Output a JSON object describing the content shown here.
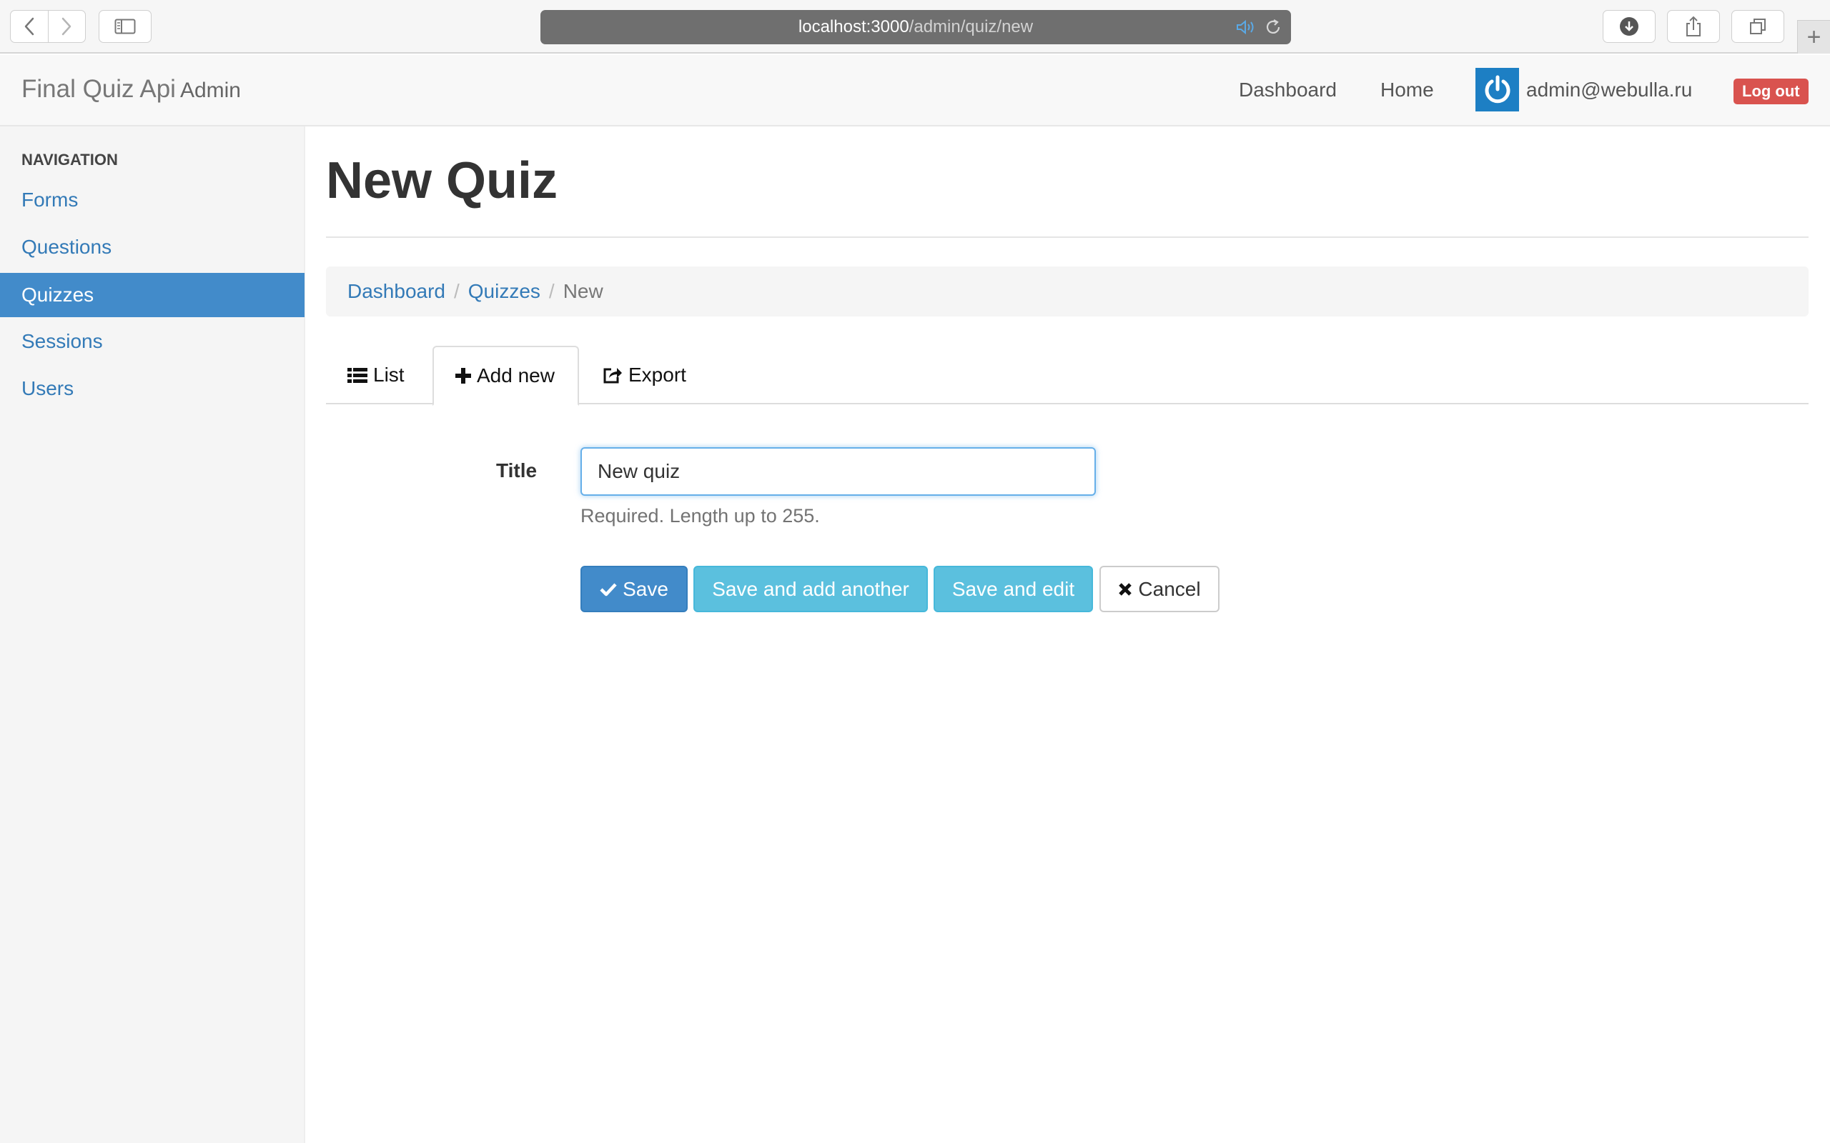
{
  "browser": {
    "url_host": "localhost:3000",
    "url_path": "/admin/quiz/new",
    "new_tab_label": "+"
  },
  "navbar": {
    "brand": "Final Quiz Api",
    "brand_sub": "Admin",
    "links": [
      "Dashboard",
      "Home"
    ],
    "user_email": "admin@webulla.ru",
    "logout_label": "Log out"
  },
  "sidebar": {
    "heading": "NAVIGATION",
    "items": [
      {
        "label": "Forms",
        "active": false
      },
      {
        "label": "Questions",
        "active": false
      },
      {
        "label": "Quizzes",
        "active": true
      },
      {
        "label": "Sessions",
        "active": false
      },
      {
        "label": "Users",
        "active": false
      }
    ]
  },
  "main": {
    "page_title": "New Quiz",
    "breadcrumb": [
      "Dashboard",
      "Quizzes",
      "New"
    ],
    "breadcrumb_separator": "/",
    "tabs": [
      {
        "label": "List",
        "icon": "list-icon",
        "active": false
      },
      {
        "label": "Add new",
        "icon": "plus-icon",
        "active": true
      },
      {
        "label": "Export",
        "icon": "share-icon",
        "active": false
      }
    ]
  },
  "form": {
    "title_label": "Title",
    "title_value": "New quiz",
    "title_help": "Required. Length up to 255.",
    "buttons": {
      "save": "Save",
      "save_add_another": "Save and add another",
      "save_edit": "Save and edit",
      "cancel": "Cancel"
    }
  },
  "colors": {
    "primary": "#428bca",
    "info": "#5bc0de",
    "danger": "#d9534f",
    "link": "#337ab7",
    "avatar": "#1d7fc4"
  }
}
